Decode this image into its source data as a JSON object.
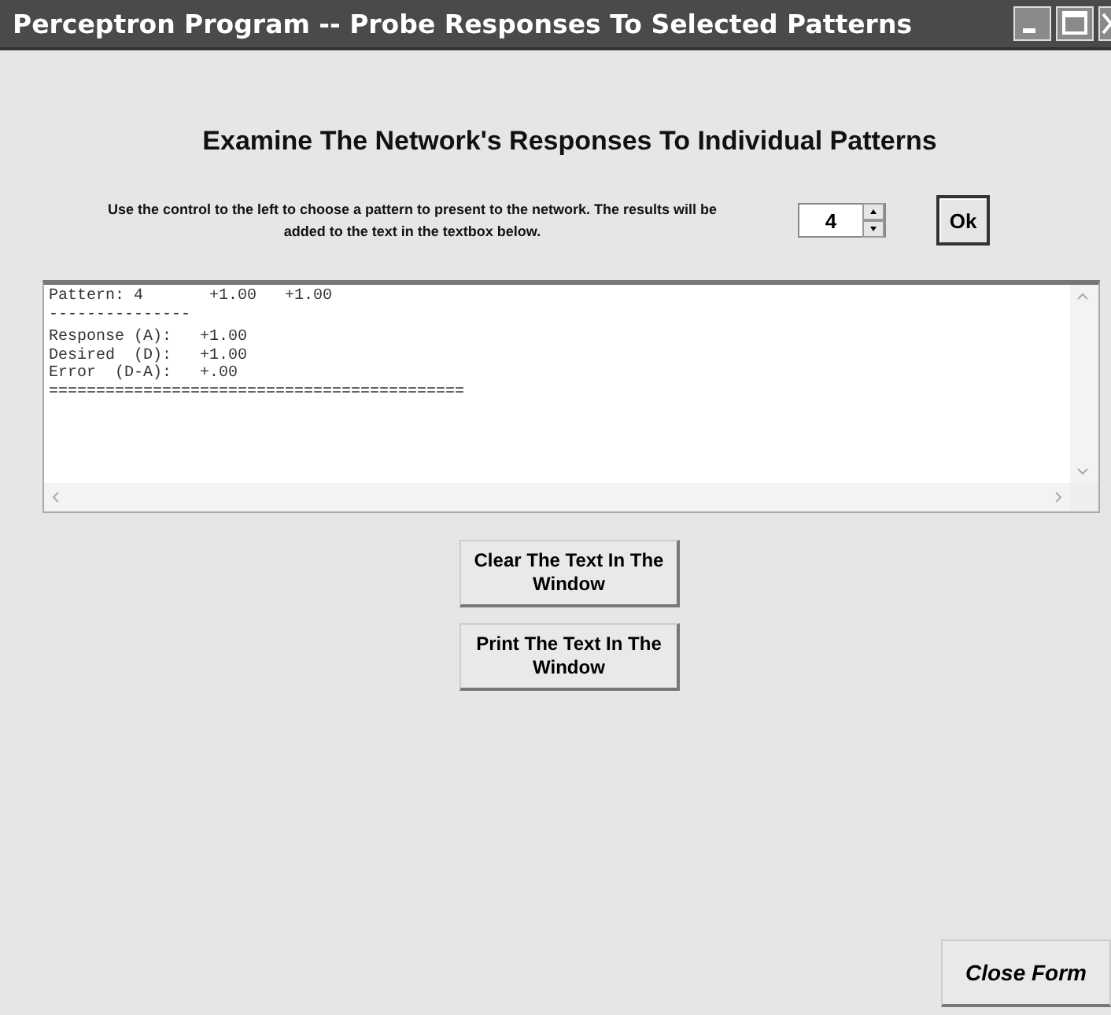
{
  "window": {
    "title": "Perceptron Program -- Probe Responses To Selected Patterns"
  },
  "heading": "Examine The Network's Responses To Individual Patterns",
  "instructions": "Use the control to the left to choose a pattern to present to the network.  The results will be added to the text in the textbox below.",
  "pattern_spinner": {
    "value": "4"
  },
  "ok_button": "Ok",
  "output_text": [
    "Pattern: 4       +1.00   +1.00",
    "---------------",
    "Response (A):   +1.00",
    "Desired  (D):   +1.00",
    "Error  (D-A):   +.00",
    "============================================"
  ],
  "buttons": [
    "Clear The Text In The Window",
    "Print The Text In The Window"
  ],
  "close_button": "Close Form"
}
